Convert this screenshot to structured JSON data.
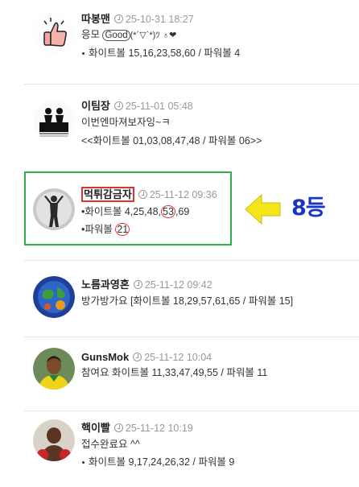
{
  "comments": [
    {
      "author": "따봉맨",
      "timestamp": "25-10-31 18:27",
      "line1_a": "응모 ",
      "line1_b": "Good",
      "line1_c": "(*´▽`*)ﾂ ♁❤",
      "line2": "화이트볼 15,16,23,58,60 / 파워볼 4"
    },
    {
      "author": "이팀장",
      "timestamp": "25-11-01 05:48",
      "line1": "이번엔마져보자잉~ㅋ",
      "line2": "<<화이트볼 01,03,08,47,48 / 파워볼 06>>"
    },
    {
      "author": "먹튀감금자",
      "timestamp": "25-11-12 09:36",
      "line1_prefix": "•화이트볼 4,25,48,",
      "line1_circled": "53",
      "line1_suffix": ",69",
      "line2_prefix": "•파워볼 ",
      "line2_circled": "21"
    },
    {
      "author": "노름과영혼",
      "timestamp": "25-11-12 09:42",
      "line1": "방가방가요 [화이트볼 18,29,57,61,65 / 파워볼 15]"
    },
    {
      "author": "GunsMok",
      "timestamp": "25-11-12 10:04",
      "line1": "참여요 화이트볼 11,33,47,49,55 / 파워볼 11"
    },
    {
      "author": "핵이빨",
      "timestamp": "25-11-12 10:19",
      "line1": "접수완료요 ^^",
      "line2": "화이트볼 9,17,24,26,32 / 파워볼 9"
    }
  ],
  "annotation": {
    "rank_label": "8등",
    "arrow_color": "#f5e51a",
    "highlight_color": "#2bb24c",
    "mark_color": "#e03030",
    "rank_color": "#1a34c4"
  }
}
